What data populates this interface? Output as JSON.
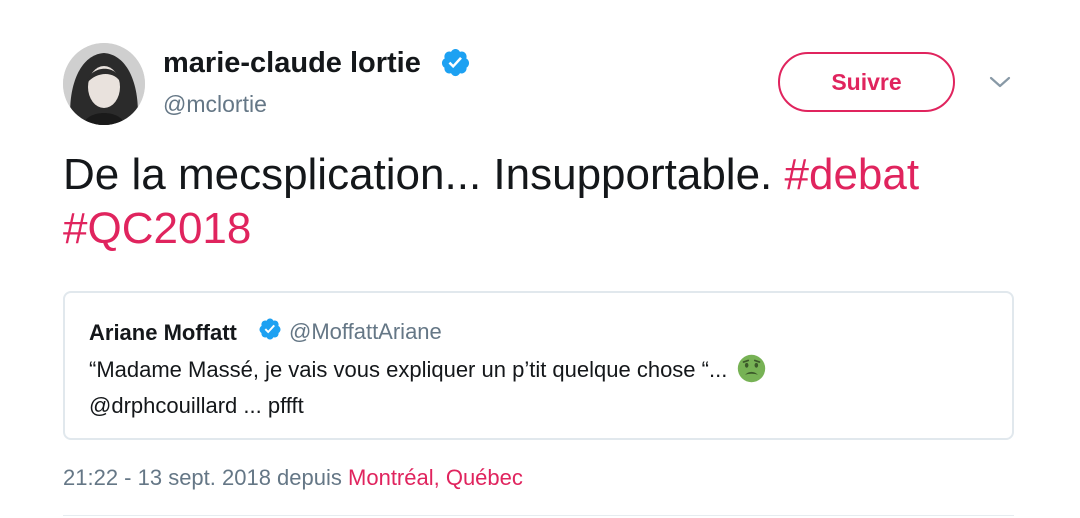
{
  "author": {
    "display_name": "marie-claude lortie",
    "handle": "@mclortie",
    "verified_icon": "verified-badge-icon"
  },
  "follow_button": {
    "label": "Suivre"
  },
  "menu_icon": "chevron-down-icon",
  "tweet": {
    "text": "De la mecsplication... Insupportable.",
    "hashtags": [
      "#debat",
      "#QC2018"
    ]
  },
  "quoted_tweet": {
    "display_name": "Ariane Moffatt",
    "handle": "@MoffattAriane",
    "text_line1": "“Madame Massé, je vais vous expliquer un p’tit quelque chose “...",
    "emoji_icon": "nauseated-face-emoji",
    "text_line2": "@drphcouillard ... pffft"
  },
  "meta": {
    "time_date": "21:22 - 13 sept. 2018 depuis",
    "location": "Montréal, Québec"
  },
  "colors": {
    "accent": "#e0245e",
    "verified": "#1da1f2",
    "secondary_text": "#657786",
    "border": "#e1e8ed"
  }
}
